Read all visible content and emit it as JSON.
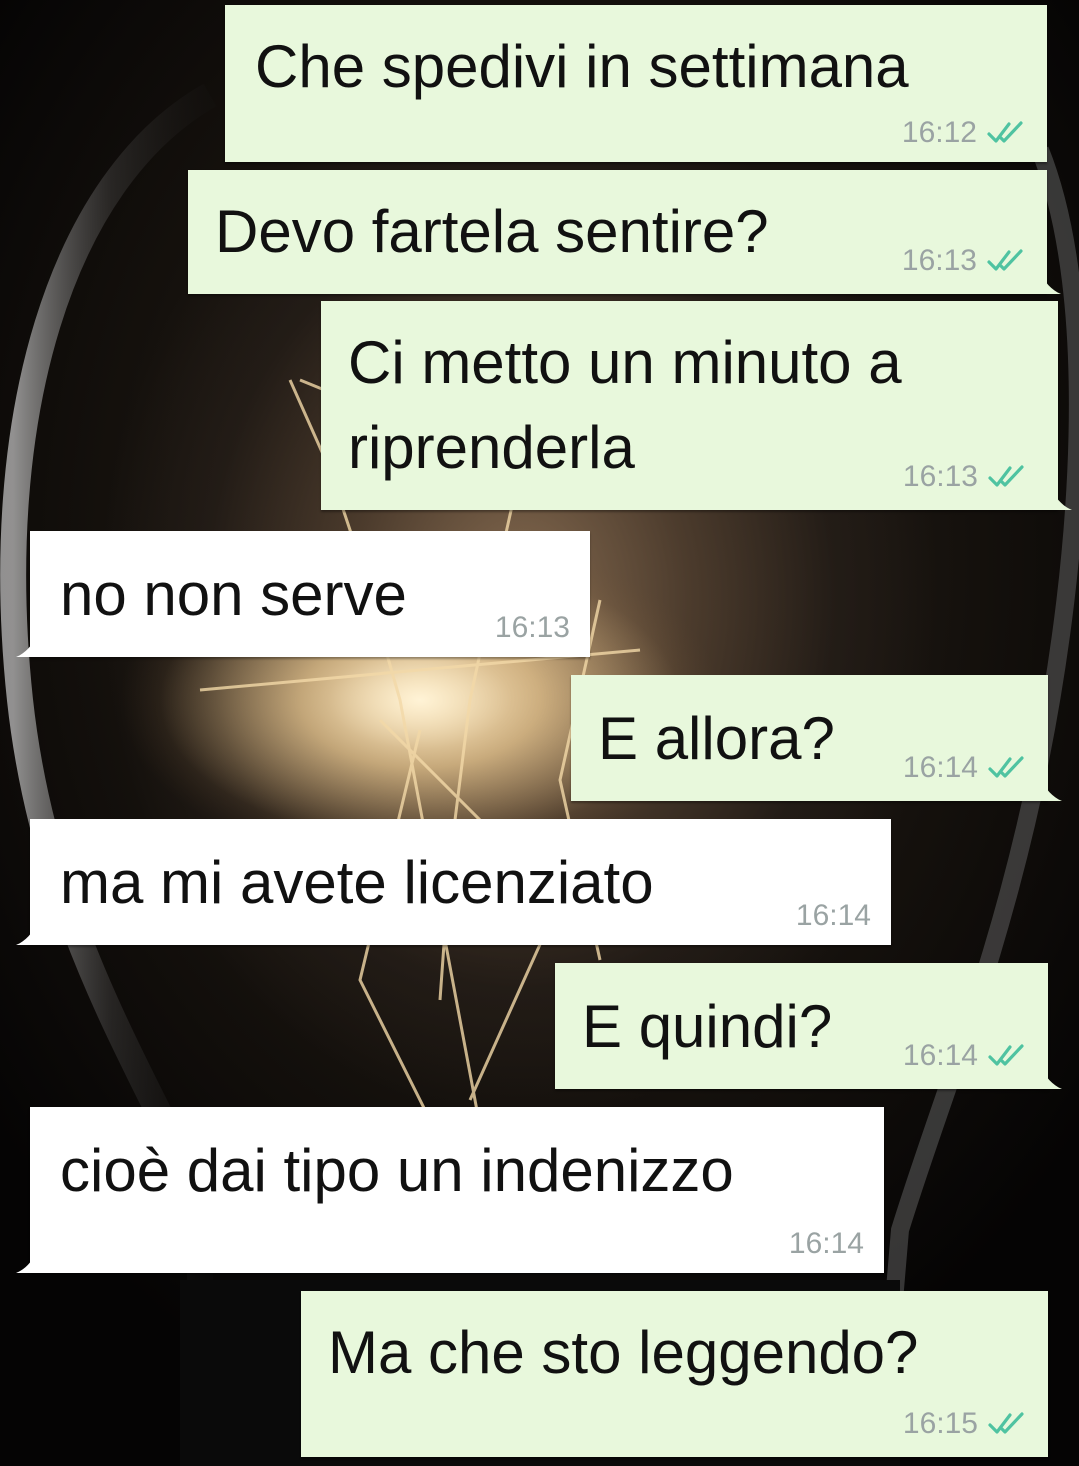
{
  "chat": {
    "messages": [
      {
        "direction": "out",
        "text": "Che spedivi in settimana",
        "time": "16:12",
        "status": "read-double-check"
      },
      {
        "direction": "out",
        "text": "Devo fartela sentire?",
        "time": "16:13",
        "status": "read-double-check"
      },
      {
        "direction": "out",
        "text_lines": [
          "Ci metto un minuto a",
          "riprenderla"
        ],
        "time": "16:13",
        "status": "read-double-check"
      },
      {
        "direction": "in",
        "text": "no non serve",
        "time": "16:13"
      },
      {
        "direction": "out",
        "text": "E allora?",
        "time": "16:14",
        "status": "read-double-check"
      },
      {
        "direction": "in",
        "text": "ma mi avete licenziato",
        "time": "16:14"
      },
      {
        "direction": "out",
        "text": "E quindi?",
        "time": "16:14",
        "status": "read-double-check"
      },
      {
        "direction": "in",
        "text": "cioè dai tipo un indenizzo",
        "time": "16:14"
      },
      {
        "direction": "out",
        "text": "Ma che sto leggendo?",
        "time": "16:15",
        "status": "read-double-check"
      }
    ]
  },
  "colors": {
    "outgoing_bubble": "#e8f8dc",
    "incoming_bubble": "#ffffff",
    "timestamp": "#9aa3a3",
    "read_check": "#4fc3a1"
  },
  "icons": {
    "wallpaper": "light-bulb-photo",
    "status": "double-check-icon"
  }
}
